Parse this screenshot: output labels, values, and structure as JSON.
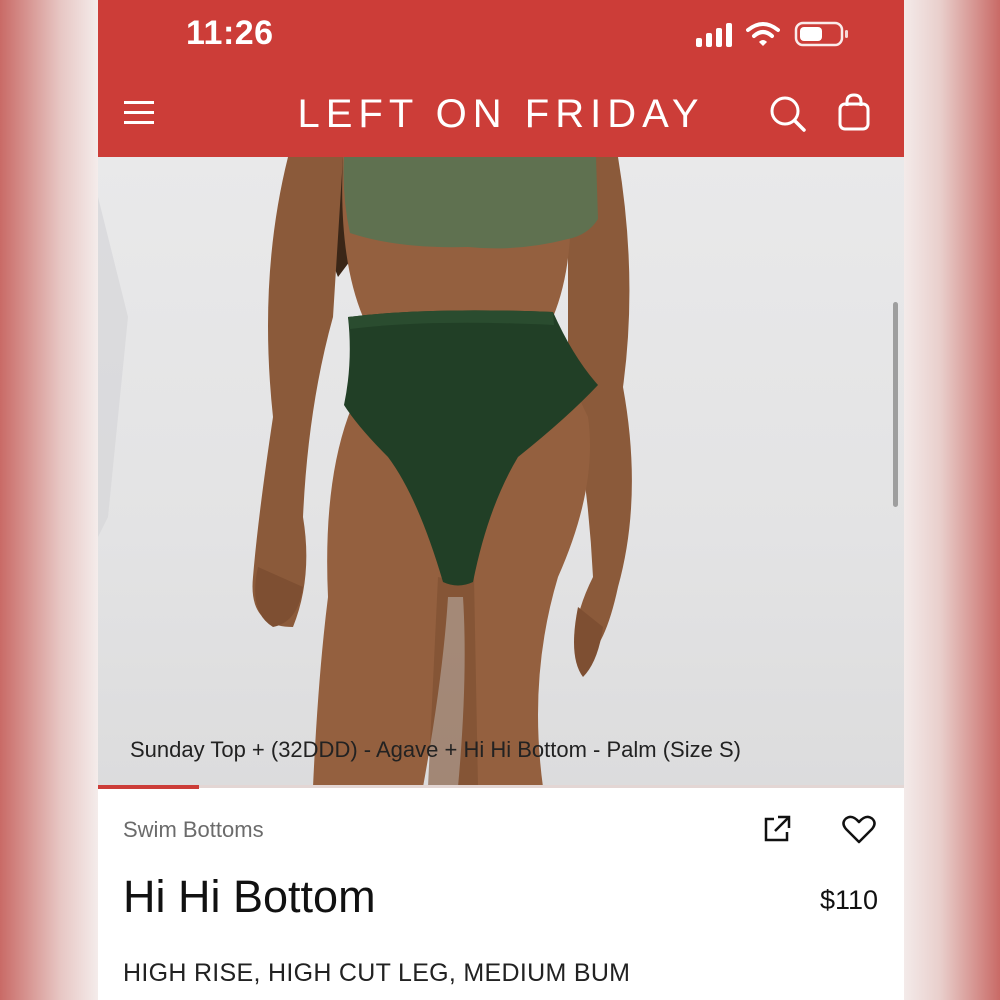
{
  "status_bar": {
    "time": "11:26"
  },
  "header": {
    "brand": "LEFT ON FRIDAY"
  },
  "hero": {
    "caption": "Sunday Top + (32DDD) - Agave + Hi Hi Bottom - Palm (Size S)"
  },
  "gallery": {
    "progress_fraction": 0.125
  },
  "product": {
    "category": "Swim Bottoms",
    "title": "Hi Hi Bottom",
    "price": "$110",
    "description": "HIGH RISE, HIGH CUT LEG, MEDIUM BUM"
  },
  "colors": {
    "header": "#cc3d38",
    "top_color": "#5f7150",
    "bottom_color": "#213f26"
  },
  "icons": [
    "menu-icon",
    "search-icon",
    "bag-icon",
    "share-icon",
    "heart-icon",
    "signal-icon",
    "wifi-icon",
    "battery-icon"
  ]
}
